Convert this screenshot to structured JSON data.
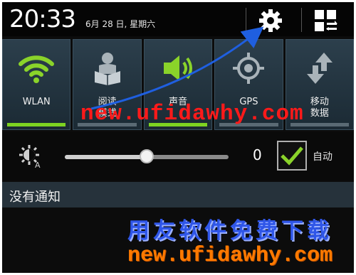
{
  "status_bar": {
    "time": "20:33",
    "date": "6月 28 日, 星期六",
    "settings_icon": "gear-icon",
    "edit_icon": "grid-edit-icon"
  },
  "quick_toggles": [
    {
      "label": "WLAN",
      "icon": "wifi-icon",
      "state": "on"
    },
    {
      "label": "阅读\n模式",
      "icon": "reader-icon",
      "state": "off"
    },
    {
      "label": "声音",
      "icon": "speaker-icon",
      "state": "on"
    },
    {
      "label": "GPS",
      "icon": "gps-icon",
      "state": "off"
    },
    {
      "label": "移动\n数据",
      "icon": "mobile-data-icon",
      "state": "off"
    }
  ],
  "brightness": {
    "value_text": "0",
    "level": 0.5,
    "auto_label": "自动",
    "auto_checked": true
  },
  "notifications": {
    "header": "没有通知"
  },
  "watermarks": {
    "red": "new.ufidawhy.com",
    "blue": "用友软件免费下载",
    "orange": "new.ufidawhy.com"
  },
  "colors": {
    "accent_green": "#7ed321",
    "arrow_blue": "#1f5fe0",
    "watermark_red": "#ff1a1a",
    "watermark_blue": "#2f56e8",
    "watermark_orange": "#ff7a00"
  }
}
